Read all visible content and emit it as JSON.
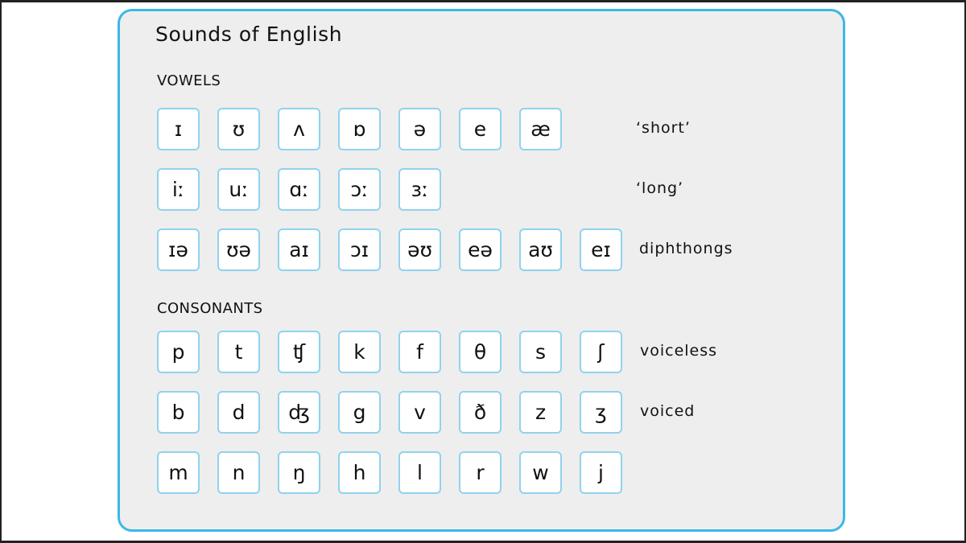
{
  "title": "Sounds of English",
  "sections": [
    {
      "heading": "VOWELS",
      "rows": [
        {
          "label": "‘short’",
          "symbols": [
            "ɪ",
            "ʊ",
            "ʌ",
            "ɒ",
            "ə",
            "e",
            "æ"
          ]
        },
        {
          "label": "‘long’",
          "symbols": [
            "iː",
            "uː",
            "ɑː",
            "ɔː",
            "ɜː"
          ]
        },
        {
          "label": "diphthongs",
          "symbols": [
            "ɪə",
            "ʊə",
            "aɪ",
            "ɔɪ",
            "əʊ",
            "eə",
            "aʊ",
            "eɪ"
          ]
        }
      ]
    },
    {
      "heading": "CONSONANTS",
      "rows": [
        {
          "label": "voiceless",
          "symbols": [
            "p",
            "t",
            "ʧ",
            "k",
            "f",
            "θ",
            "s",
            "ʃ"
          ]
        },
        {
          "label": "voiced",
          "symbols": [
            "b",
            "d",
            "ʤ",
            "g",
            "v",
            "ð",
            "z",
            "ʒ"
          ]
        },
        {
          "label": "",
          "symbols": [
            "m",
            "n",
            "ŋ",
            "h",
            "l",
            "r",
            "w",
            "j"
          ]
        }
      ]
    }
  ],
  "colors": {
    "panel_border": "#3bb8e6",
    "box_border": "#8fd3ee",
    "panel_background": "#eeeeee",
    "box_background": "#ffffff"
  }
}
